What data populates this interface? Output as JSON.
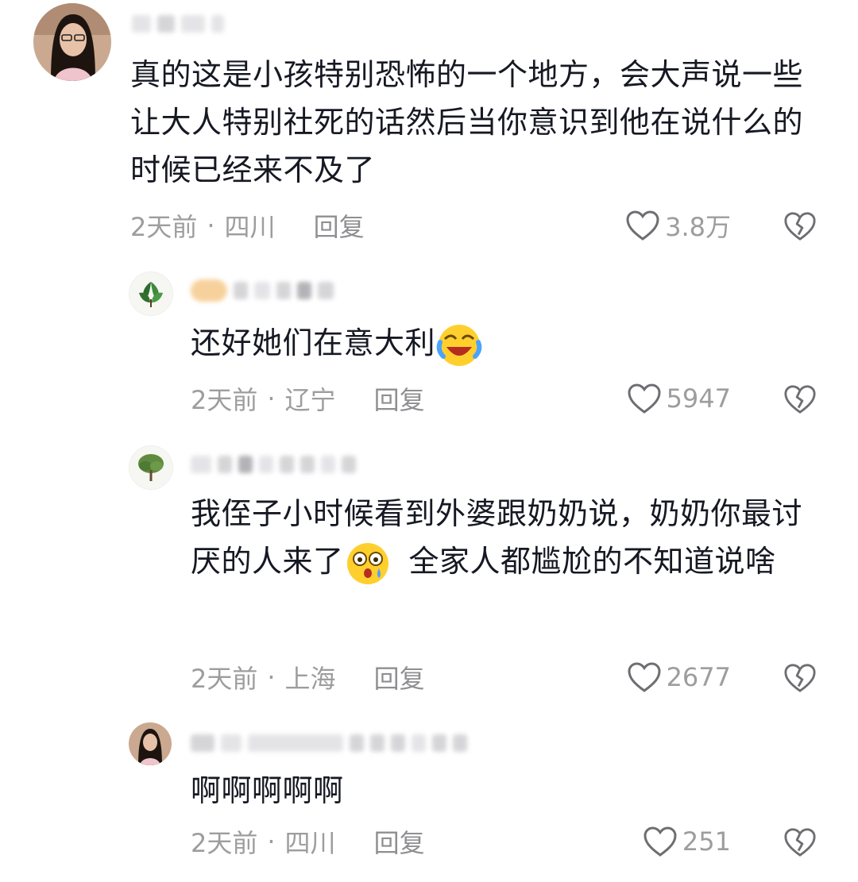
{
  "comments": [
    {
      "text": "真的这是小孩特别恐怖的一个地方，会大声说一些让大人特别社死的话然后当你意识到他在说什么的时候已经来不及了",
      "time": "2天前",
      "location": "四川",
      "reply": "回复",
      "likes": "3.8万"
    },
    {
      "text": "还好她们在意大利",
      "emoji": "laughing-crying-emoji",
      "time": "2天前",
      "location": "辽宁",
      "reply": "回复",
      "likes": "5947"
    },
    {
      "text_a": "我侄子小时候看到外婆跟奶奶说，奶奶你最讨厌的人来了",
      "emoji": "shocked-emoji",
      "text_b": "全家人都尴尬的不知道说啥",
      "time": "2天前",
      "location": "上海",
      "reply": "回复",
      "likes": "2677"
    },
    {
      "text": "啊啊啊啊啊",
      "time": "2天前",
      "location": "四川",
      "reply": "回复",
      "likes": "251"
    }
  ],
  "meta_separator": "·",
  "colors": {
    "text": "#161823",
    "meta": "#9d9d9f",
    "icon": "#6e6e72"
  }
}
